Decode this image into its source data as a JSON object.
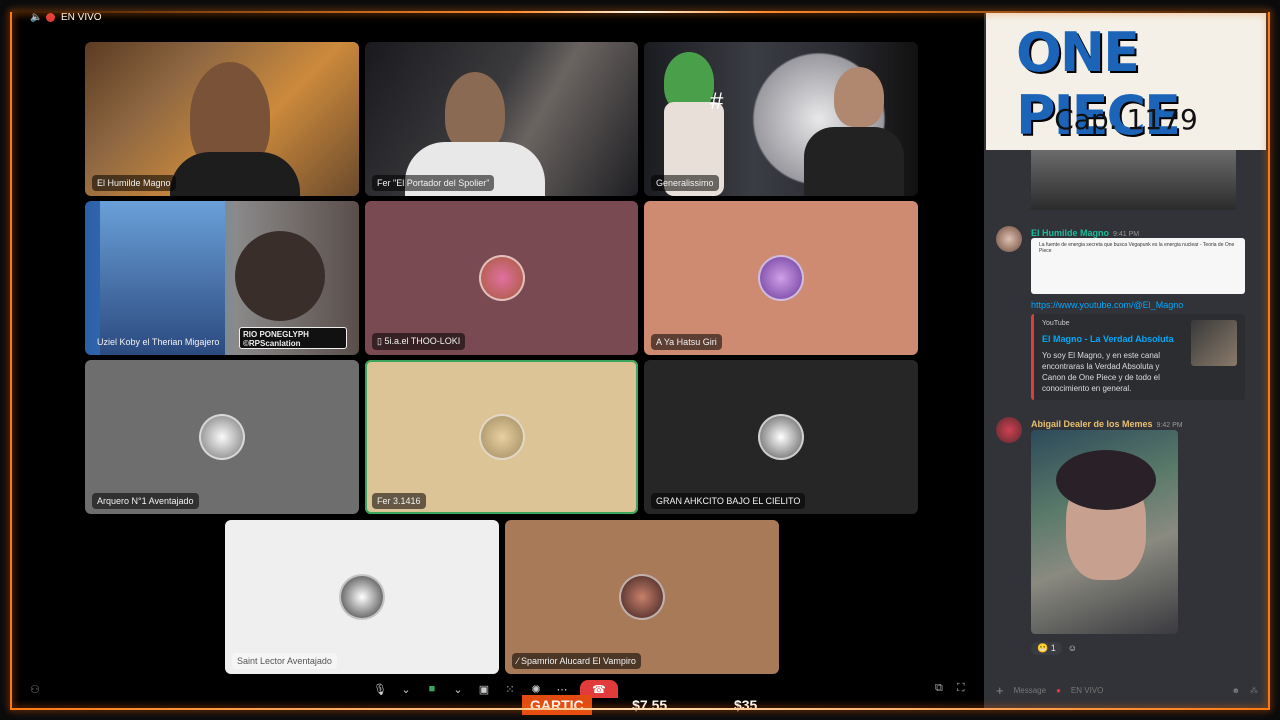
{
  "live_label": "EN VIVO",
  "tiles": [
    {
      "label": "El Humilde Magno"
    },
    {
      "label": "Fer \"El Portador del Spolier\""
    },
    {
      "label": "Generalissimo"
    },
    {
      "label": "Uziel Koby el Therian Migajero"
    },
    {
      "label": "5i.a.el THOO-LOKI"
    },
    {
      "label": "A Ya Hatsu Giri"
    },
    {
      "label": "Arquero N°1 Aventajado"
    },
    {
      "label": "Fer 3.1416"
    },
    {
      "label": "GRAN AHKCITO BAJO EL CIELITO"
    },
    {
      "label": "Saint Lector Aventajado"
    },
    {
      "label": "Spamrior Alucard El Vampiro"
    }
  ],
  "overlay": {
    "one_piece_logo": "ONE PIECE",
    "chapter": "Cap. 1179",
    "watermark": "RIO PONEGLYPH  ©RPScanlation"
  },
  "chat": {
    "msg1": {
      "author": "El Humilde Magno",
      "time": "9:41 PM",
      "link": "https://www.youtube.com/@El_Magno",
      "preview_title": "La fuente de energia secreta que busca Vegapunk es la energia nuclear - Teoria de One Piece"
    },
    "embed": {
      "source": "YouTube",
      "title": "El Magno - La Verdad Absoluta",
      "desc": "Yo soy El Magno, y en este canal encontraras la Verdad Absoluta y Canon de One Piece y de todo el conocimiento en general."
    },
    "msg2": {
      "author": "Abigail Dealer de los Memes",
      "time": "9:42 PM"
    },
    "reaction_count": "1",
    "composer_placeholder": "Message",
    "composer_channel": "EN VIVO"
  },
  "ticker": {
    "gartic": "GARTIC",
    "price1": "$7.55",
    "price2": "$35"
  },
  "colors": {
    "accent_orange": "#ff7a10",
    "live_red": "#e23b3b",
    "speaking_green": "#3ba55d",
    "link_blue": "#00a8fc"
  }
}
